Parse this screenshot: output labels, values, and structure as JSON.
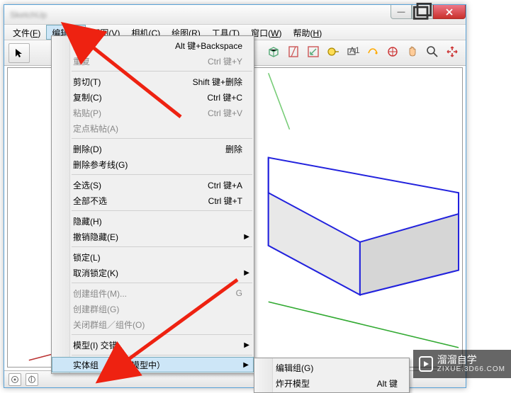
{
  "window": {
    "title": "SketchUp"
  },
  "menubar": {
    "items": [
      {
        "label": "文件",
        "hotkey": "F"
      },
      {
        "label": "编辑",
        "hotkey": "E"
      },
      {
        "label": "视图",
        "hotkey": "V"
      },
      {
        "label": "相机",
        "hotkey": "C"
      },
      {
        "label": "绘图",
        "hotkey": "R"
      },
      {
        "label": "工具",
        "hotkey": "T"
      },
      {
        "label": "窗口",
        "hotkey": "W"
      },
      {
        "label": "帮助",
        "hotkey": "H"
      }
    ]
  },
  "dropdown": {
    "items": [
      {
        "label": "撤销",
        "shortcut": "Alt 键+Backspace",
        "disabled": false
      },
      {
        "label": "重复",
        "shortcut": "Ctrl 键+Y",
        "disabled": true
      },
      {
        "sep": true
      },
      {
        "label": "剪切(T)",
        "shortcut": "Shift 键+删除",
        "disabled": false
      },
      {
        "label": "复制(C)",
        "shortcut": "Ctrl 键+C",
        "disabled": false
      },
      {
        "label": "粘贴(P)",
        "shortcut": "Ctrl 键+V",
        "disabled": true
      },
      {
        "label": "定点粘帖(A)",
        "shortcut": "",
        "disabled": true
      },
      {
        "sep": true
      },
      {
        "label": "删除(D)",
        "shortcut": "删除",
        "disabled": false
      },
      {
        "label": "删除参考线(G)",
        "shortcut": "",
        "disabled": false
      },
      {
        "sep": true
      },
      {
        "label": "全选(S)",
        "shortcut": "Ctrl 键+A",
        "disabled": false
      },
      {
        "label": "全部不选",
        "shortcut": "Ctrl 键+T",
        "disabled": false
      },
      {
        "sep": true
      },
      {
        "label": "隐藏(H)",
        "shortcut": "",
        "disabled": false
      },
      {
        "label": "撤销隐藏(E)",
        "shortcut": "",
        "disabled": false,
        "submenu": true
      },
      {
        "sep": true
      },
      {
        "label": "锁定(L)",
        "shortcut": "",
        "disabled": false
      },
      {
        "label": "取消锁定(K)",
        "shortcut": "",
        "disabled": false,
        "submenu": true
      },
      {
        "sep": true
      },
      {
        "label": "创建组件(M)...",
        "shortcut": "G",
        "disabled": true
      },
      {
        "label": "创建群组(G)",
        "shortcut": "",
        "disabled": true
      },
      {
        "label": "关闭群组／组件(O)",
        "shortcut": "",
        "disabled": true
      },
      {
        "sep": true
      },
      {
        "label": "模型(I) 交错",
        "shortcut": "",
        "disabled": false,
        "submenu": true
      },
      {
        "sep": true
      },
      {
        "label": "实体组 （1，在模型中）",
        "shortcut": "",
        "disabled": false,
        "submenu": true,
        "highlight": true
      }
    ]
  },
  "submenu": {
    "items": [
      {
        "label": "编辑组(G)",
        "shortcut": ""
      },
      {
        "label": "炸开模型",
        "shortcut": "Alt 键"
      }
    ]
  },
  "watermark": {
    "brand": "溜溜自学",
    "domain": "ZIXUE.3D66.COM"
  }
}
